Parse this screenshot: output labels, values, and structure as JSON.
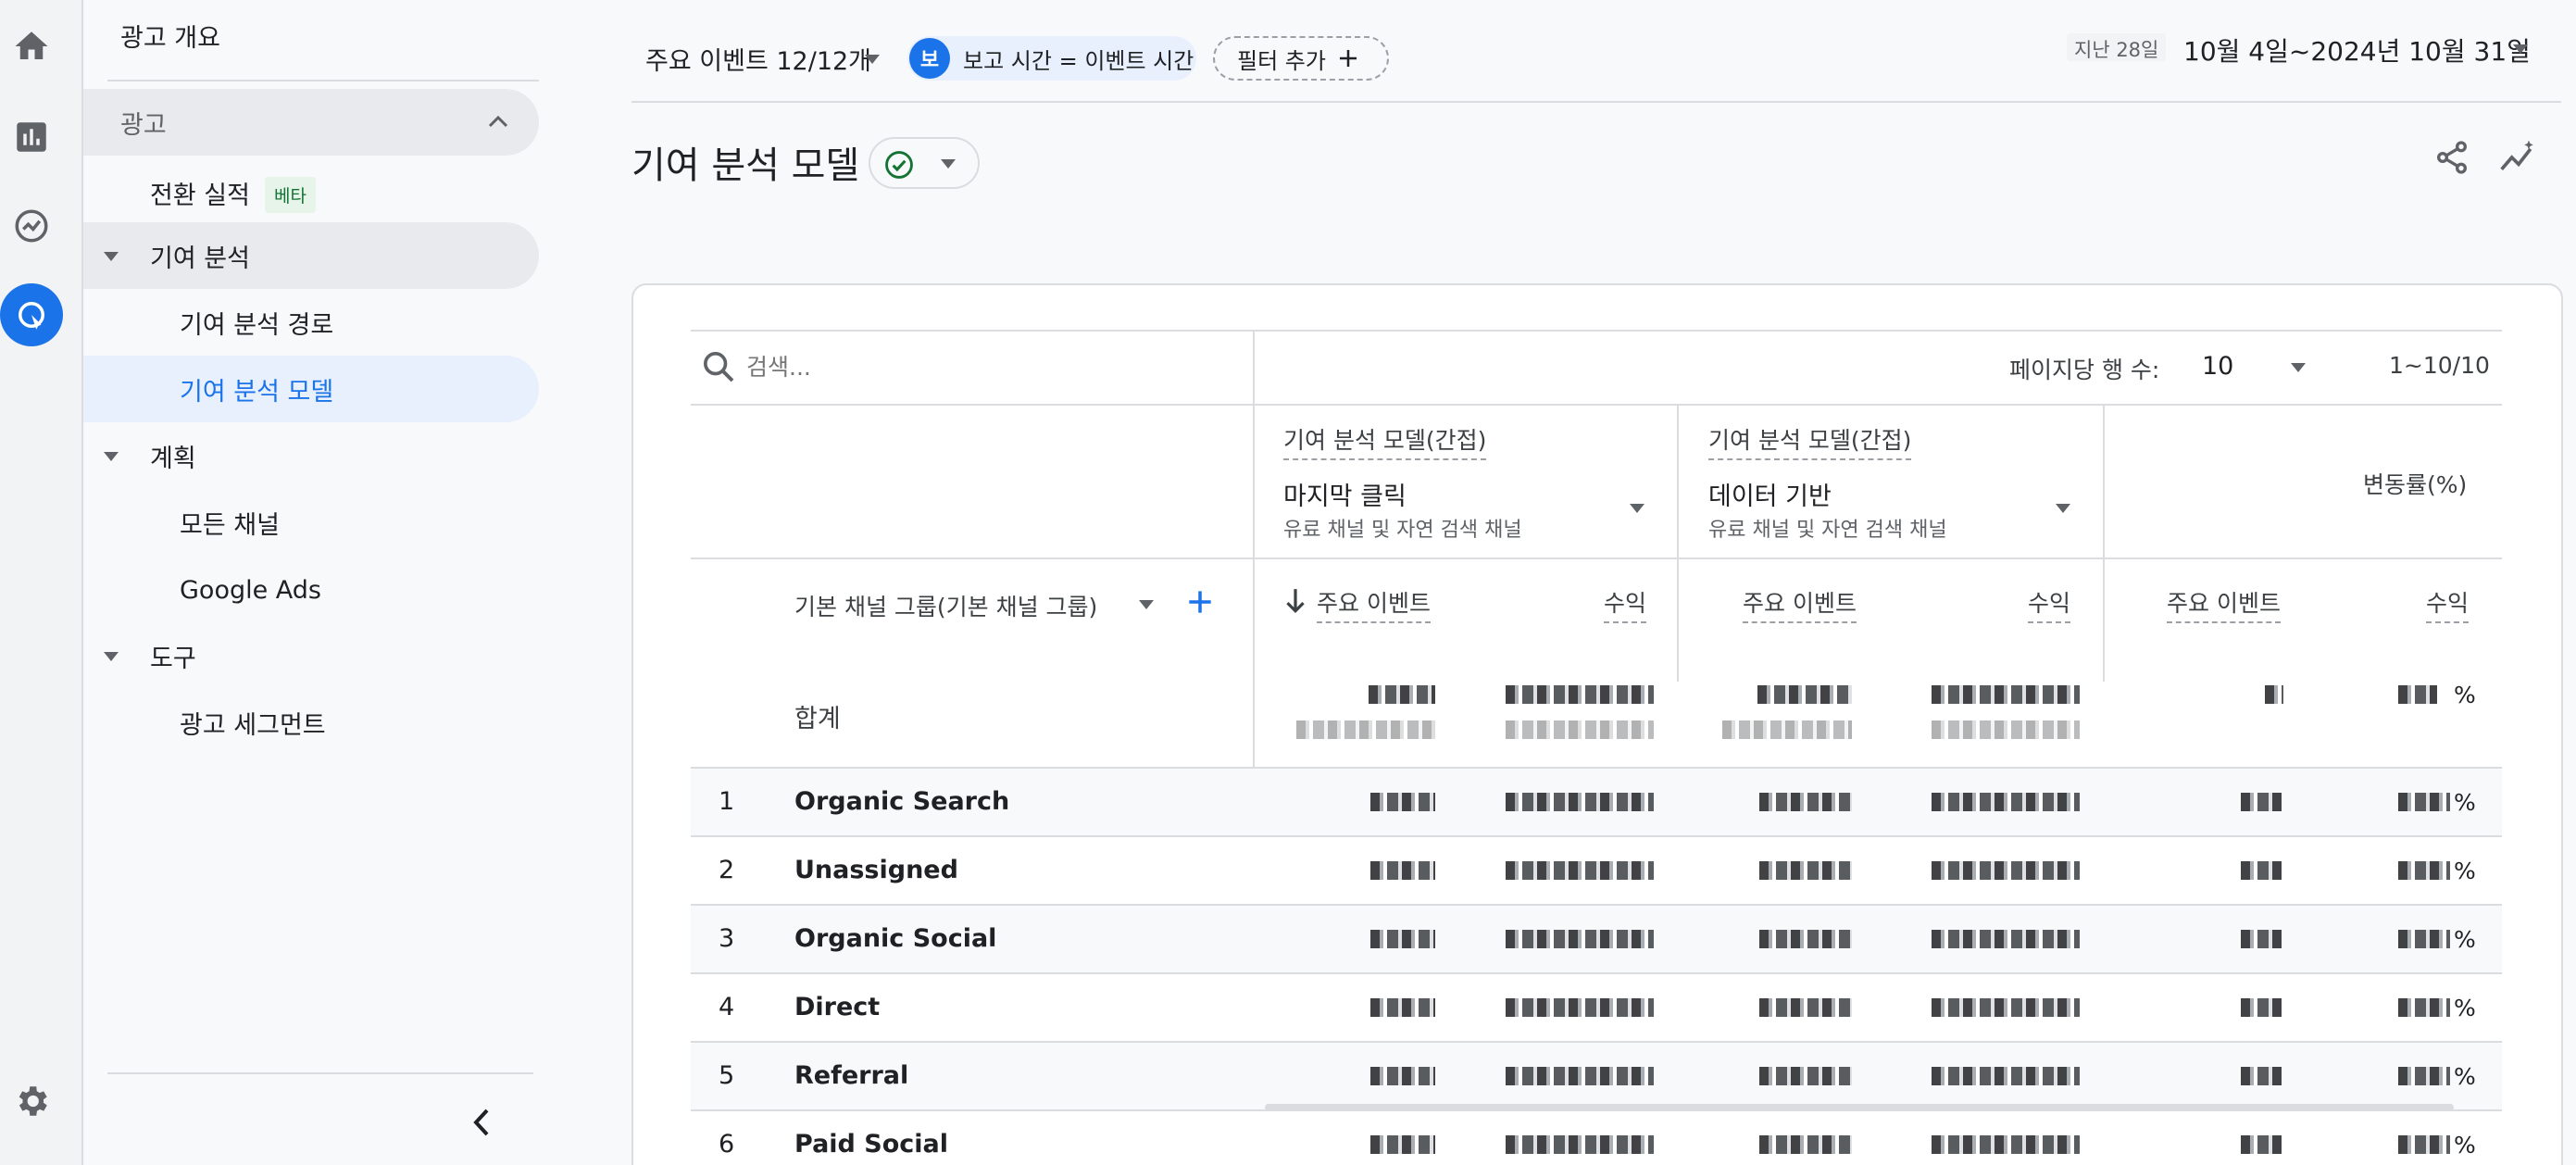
{
  "rail": {
    "icons": [
      "home-icon",
      "reports-icon",
      "explore-icon",
      "advertising-icon",
      "settings-icon"
    ]
  },
  "nav": {
    "ads_overview": "광고 개요",
    "ads_section": "광고",
    "conversion_performance": "전환 실적",
    "beta_badge": "베타",
    "attribution": "기여 분석",
    "attribution_paths": "기여 분석 경로",
    "attribution_models": "기여 분석 모델",
    "planning": "계획",
    "all_channels": "모든 채널",
    "google_ads": "Google Ads",
    "tools": "도구",
    "ad_segments": "광고 세그먼트"
  },
  "header": {
    "key_events": "주요 이벤트 12/12개",
    "avatar_letter": "보",
    "report_time_chip": "보고 시간 = 이벤트 시간",
    "add_filter": "필터 추가",
    "date_range_prefix": "지난 28일",
    "date_range": "10월 4일~2024년 10월 31일"
  },
  "page": {
    "title": "기여 분석 모델"
  },
  "table": {
    "search_placeholder": "검색...",
    "rows_per_page_label": "페이지당 행 수:",
    "rows_per_page_value": "10",
    "pagination": "1~10/10",
    "model1": {
      "label": "기여 분석 모델(간접)",
      "name": "마지막 클릭",
      "scope": "유료 채널 및 자연 검색 채널"
    },
    "model2": {
      "label": "기여 분석 모델(간접)",
      "name": "데이터 기반",
      "scope": "유료 채널 및 자연 검색 채널"
    },
    "change_label": "변동률(%)",
    "dimension": "기본 채널 그룹(기본 채널 그룹)",
    "col_key_events": "주요 이벤트",
    "col_revenue": "수익",
    "total_label": "합계",
    "percent_sign": "%",
    "rows": [
      {
        "idx": "1",
        "name": "Organic Search"
      },
      {
        "idx": "2",
        "name": "Unassigned"
      },
      {
        "idx": "3",
        "name": "Organic Social"
      },
      {
        "idx": "4",
        "name": "Direct"
      },
      {
        "idx": "5",
        "name": "Referral"
      },
      {
        "idx": "6",
        "name": "Paid Social"
      }
    ]
  },
  "colors": {
    "accent": "#1a73e8",
    "selected_bg": "#e8f0fe",
    "section_bg": "#e8eaed"
  }
}
